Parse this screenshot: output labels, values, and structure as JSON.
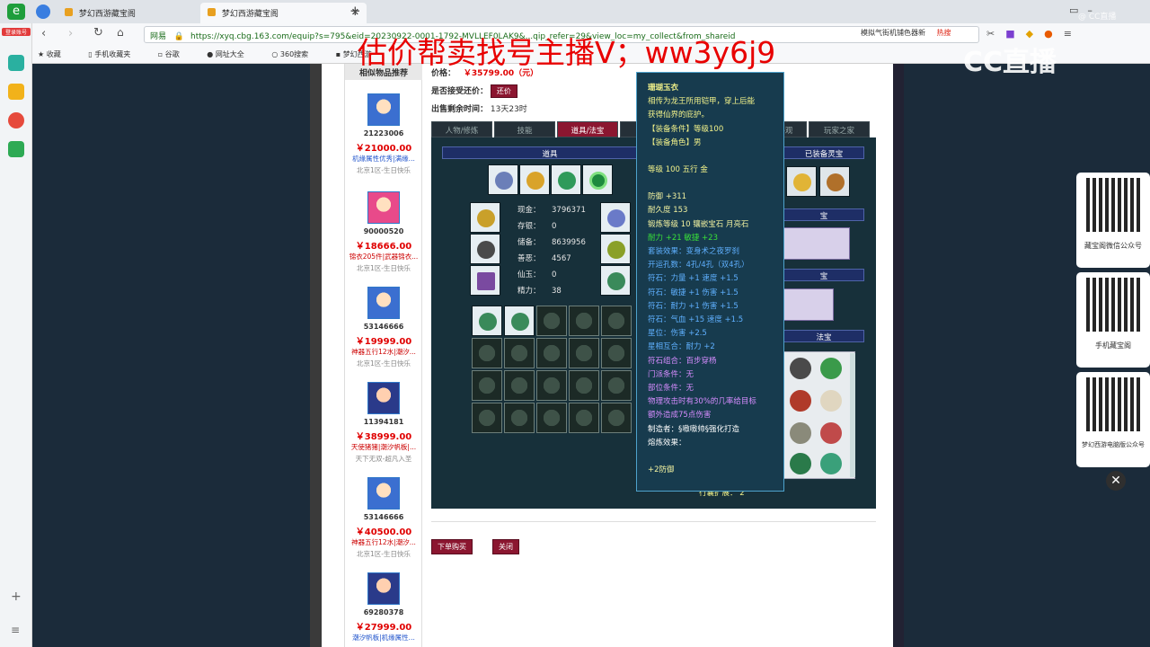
{
  "browser": {
    "tabs": [
      {
        "label": "梦幻西游藏宝阁",
        "active": false
      },
      {
        "label": "梦幻西游藏宝阁",
        "active": true
      }
    ],
    "url_prefix": "网易",
    "url": "https://xyq.cbg.163.com/equip?s=795&eid=20230922-0001-1792-MVLLEF0LAK9&...qip_refer=29&view_loc=my_collect&from_shareid",
    "side_label": "登录账号",
    "bookmarks": [
      "收藏",
      "手机收藏夹",
      "谷歌",
      "网址大全",
      "360搜索",
      "梦幻西游"
    ],
    "toolbar_right": [
      "模拟气街机铺色器新",
      "热搜"
    ]
  },
  "overlay": {
    "banner": "估价帮卖找号主播V；ww3y6j9",
    "logo": "CC直播",
    "watermark": "@ CC直播"
  },
  "similar": {
    "header": "相似物品推荐",
    "items": [
      {
        "id": "21223006",
        "price": "￥21000.00",
        "tags": "机缘属性优秀|满缘...",
        "server": "北京1区-生日快乐"
      },
      {
        "id": "90000520",
        "price": "￥18666.00",
        "tags": "锦衣205件|武器锦衣...",
        "server": "北京1区-生日快乐"
      },
      {
        "id": "53146666",
        "price": "￥19999.00",
        "tags": "神器五行12水|潮汐...",
        "server": "北京1区-生日快乐"
      },
      {
        "id": "11394181",
        "price": "￥38999.00",
        "tags": "天使猪猪|潮汐帆板|...",
        "server": "天下无双-超凡入圣"
      },
      {
        "id": "53146666",
        "price": "￥40500.00",
        "tags": "神器五行12水|潮汐...",
        "server": "北京1区-生日快乐"
      },
      {
        "id": "69280378",
        "price": "￥27999.00",
        "tags": "潮汐帆板|机缘属性...",
        "server": ""
      }
    ]
  },
  "info": {
    "price_label": "价格：",
    "price_value": "￥35799.00（元）",
    "bargain_label": "是否接受还价：",
    "bargain_button": "还价",
    "remaining_label": "出售剩余时间：",
    "remaining_value": "13天23时"
  },
  "tabs": [
    "人物/修炼",
    "技能",
    "道具/法宝",
    "召唤兽",
    "坐骑",
    "锦衣/外观",
    "玩家之家"
  ],
  "panel": {
    "items_header": "道具",
    "equipped_header": "已装备灵宝",
    "side_headers": [
      "宝",
      "宝",
      "法宝"
    ],
    "stats": [
      {
        "label": "现金：",
        "value": "3796371"
      },
      {
        "label": "存银：",
        "value": "0"
      },
      {
        "label": "储备：",
        "value": "8639956"
      },
      {
        "label": "善恶：",
        "value": "4567"
      },
      {
        "label": "仙玉：",
        "value": "0"
      },
      {
        "label": "精力：",
        "value": "38"
      }
    ],
    "footer_text": "行囊扩展：  2"
  },
  "tooltip": {
    "title": "珊瑚玉衣",
    "desc1": "相传为龙王所用铠甲，穿上后能",
    "desc2": "获得仙界的庇护。",
    "req_level": "【装备条件】等级100",
    "req_role": "【装备角色】男",
    "level_line": "等级  100  五行  金",
    "lines": [
      {
        "text": "防御 +311",
        "color": "#f2f2a0"
      },
      {
        "text": "耐久度 153",
        "color": "#f2f2a0"
      },
      {
        "text": "锻炼等级 10  镶嵌宝石 月亮石",
        "color": "#f2f2a0"
      },
      {
        "text": "耐力 +21  敏捷 +23",
        "color": "#39e039"
      },
      {
        "text": "套装效果：变身术之夜罗刹",
        "color": "#5fb0ff"
      },
      {
        "text": "开运孔数：4孔/4孔（双4孔）",
        "color": "#5fb0ff"
      },
      {
        "text": "符石：力量 +1  速度 +1.5",
        "color": "#5fb0ff"
      },
      {
        "text": "符石：敏捷 +1  伤害 +1.5",
        "color": "#5fb0ff"
      },
      {
        "text": "符石：耐力 +1  伤害 +1.5",
        "color": "#5fb0ff"
      },
      {
        "text": "符石：气血 +15  速度 +1.5",
        "color": "#5fb0ff"
      },
      {
        "text": "星位：伤害 +2.5",
        "color": "#5fb0ff"
      },
      {
        "text": "星相互合：耐力 +2",
        "color": "#5fb0ff"
      },
      {
        "text": "符石组合：百步穿杨",
        "color": "#d68cff"
      },
      {
        "text": "门派条件：无",
        "color": "#d68cff"
      },
      {
        "text": "部位条件：无",
        "color": "#d68cff"
      },
      {
        "text": "物理攻击时有30%的几率给目标",
        "color": "#d68cff"
      },
      {
        "text": "额外造成75点伤害",
        "color": "#d68cff"
      },
      {
        "text": "制造者：§嗷嗷帅§强化打造",
        "color": "#ffffff"
      },
      {
        "text": "熔炼效果：",
        "color": "#ffffff"
      },
      {
        "text": "",
        "color": "#ffffff"
      },
      {
        "text": "+2防御",
        "color": "#f2f2a0"
      }
    ]
  },
  "actions": {
    "buy": "下单购买",
    "close": "关闭"
  },
  "qr_cards": [
    {
      "caption": "藏宝阁微信公众号"
    },
    {
      "caption": "手机藏宝阁"
    },
    {
      "caption": "梦幻西游电脑版公众号"
    }
  ],
  "colors": {
    "accent": "#8b1630",
    "price_red": "#e00000",
    "banner_red": "#e80000"
  }
}
